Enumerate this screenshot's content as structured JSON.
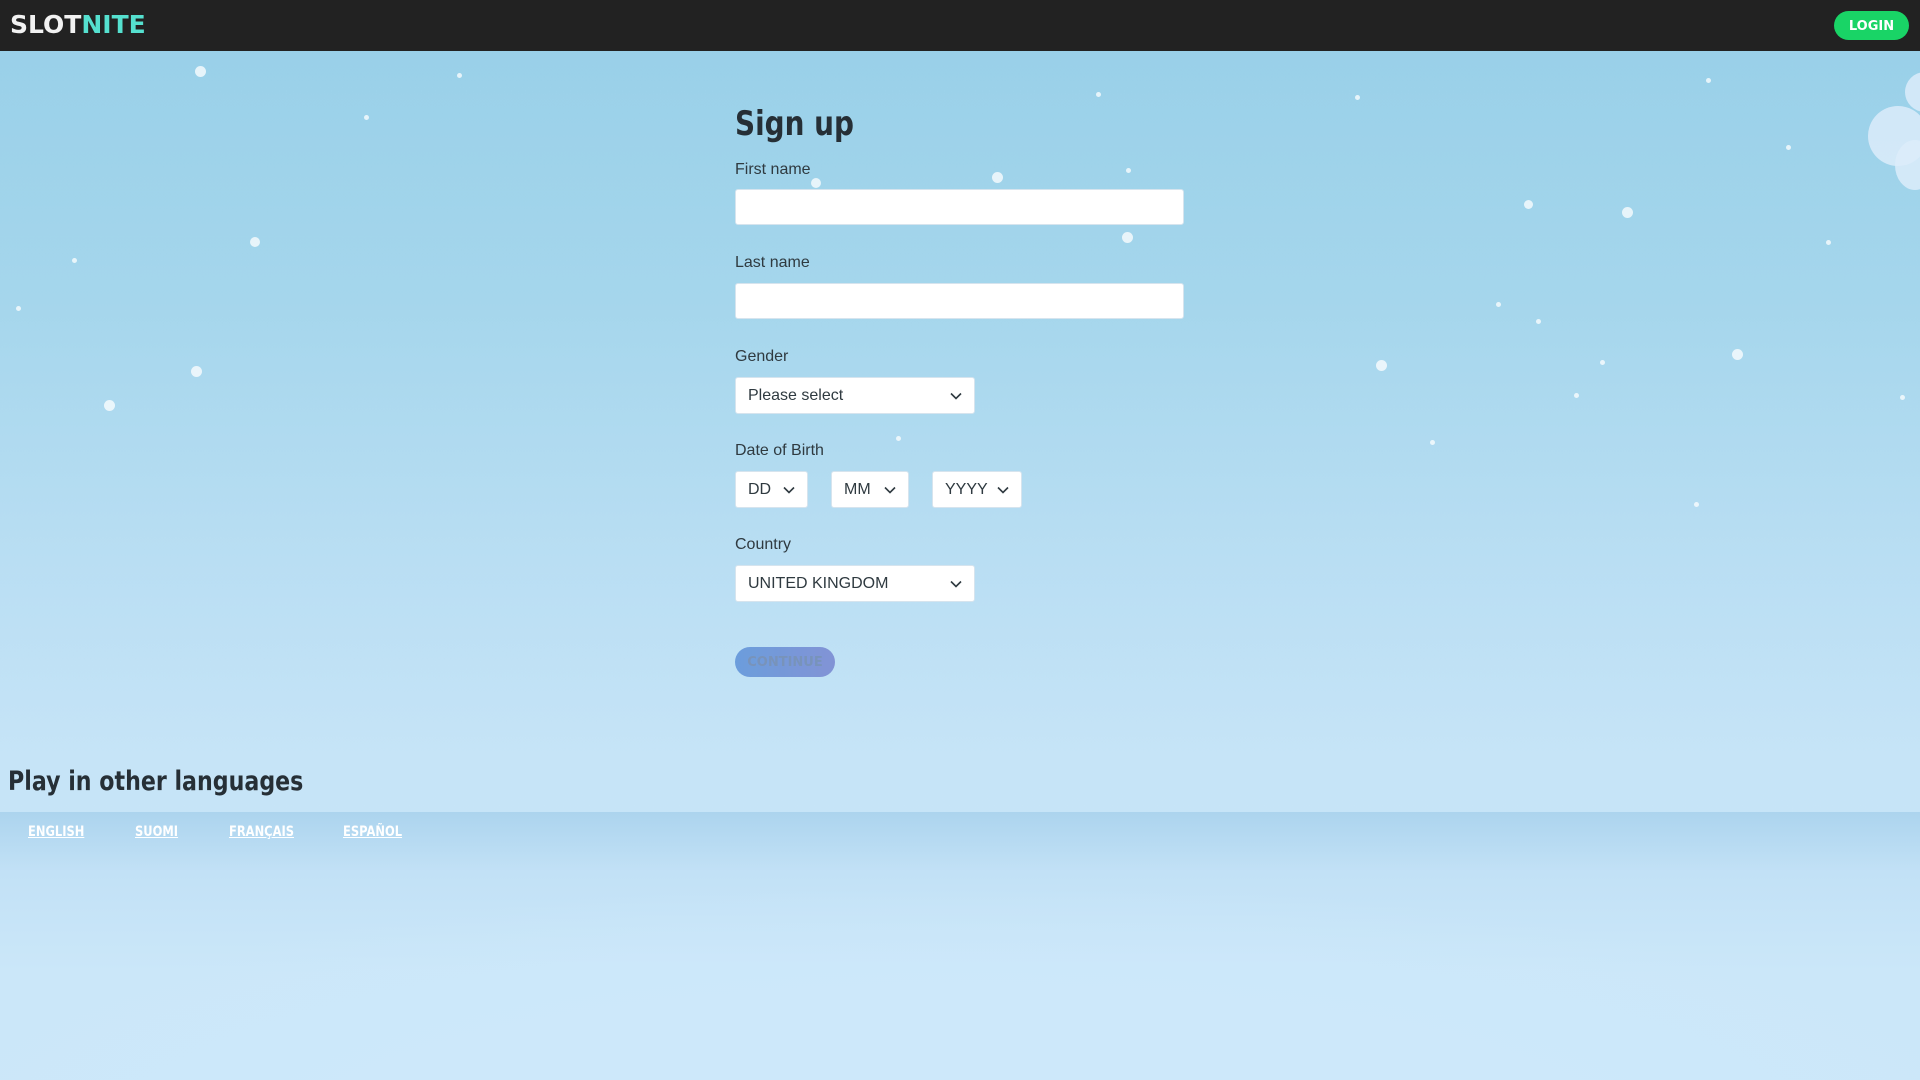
{
  "header": {
    "logo_part1": "SLOT",
    "logo_part2": "NITE",
    "login_label": "LOGIN"
  },
  "signup": {
    "title": "Sign up",
    "first_name": {
      "label": "First name",
      "value": ""
    },
    "last_name": {
      "label": "Last name",
      "value": ""
    },
    "gender": {
      "label": "Gender",
      "selected": "Please select"
    },
    "dob": {
      "label": "Date of Birth",
      "day": "DD",
      "month": "MM",
      "year": "YYYY"
    },
    "country": {
      "label": "Country",
      "selected": "UNITED KINGDOM"
    },
    "continue_label": "CONTINUE"
  },
  "languages": {
    "heading": "Play in other languages",
    "links": [
      "ENGLISH",
      "SUOMI",
      "FRANÇAIS",
      "ESPAÑOL"
    ]
  },
  "icons": [
    "chevron-down-icon"
  ],
  "colors": {
    "topbar": "#222222",
    "login_button": "#19d466",
    "logo_accent": "#55e0cf",
    "background": "#a5d6ec"
  }
}
